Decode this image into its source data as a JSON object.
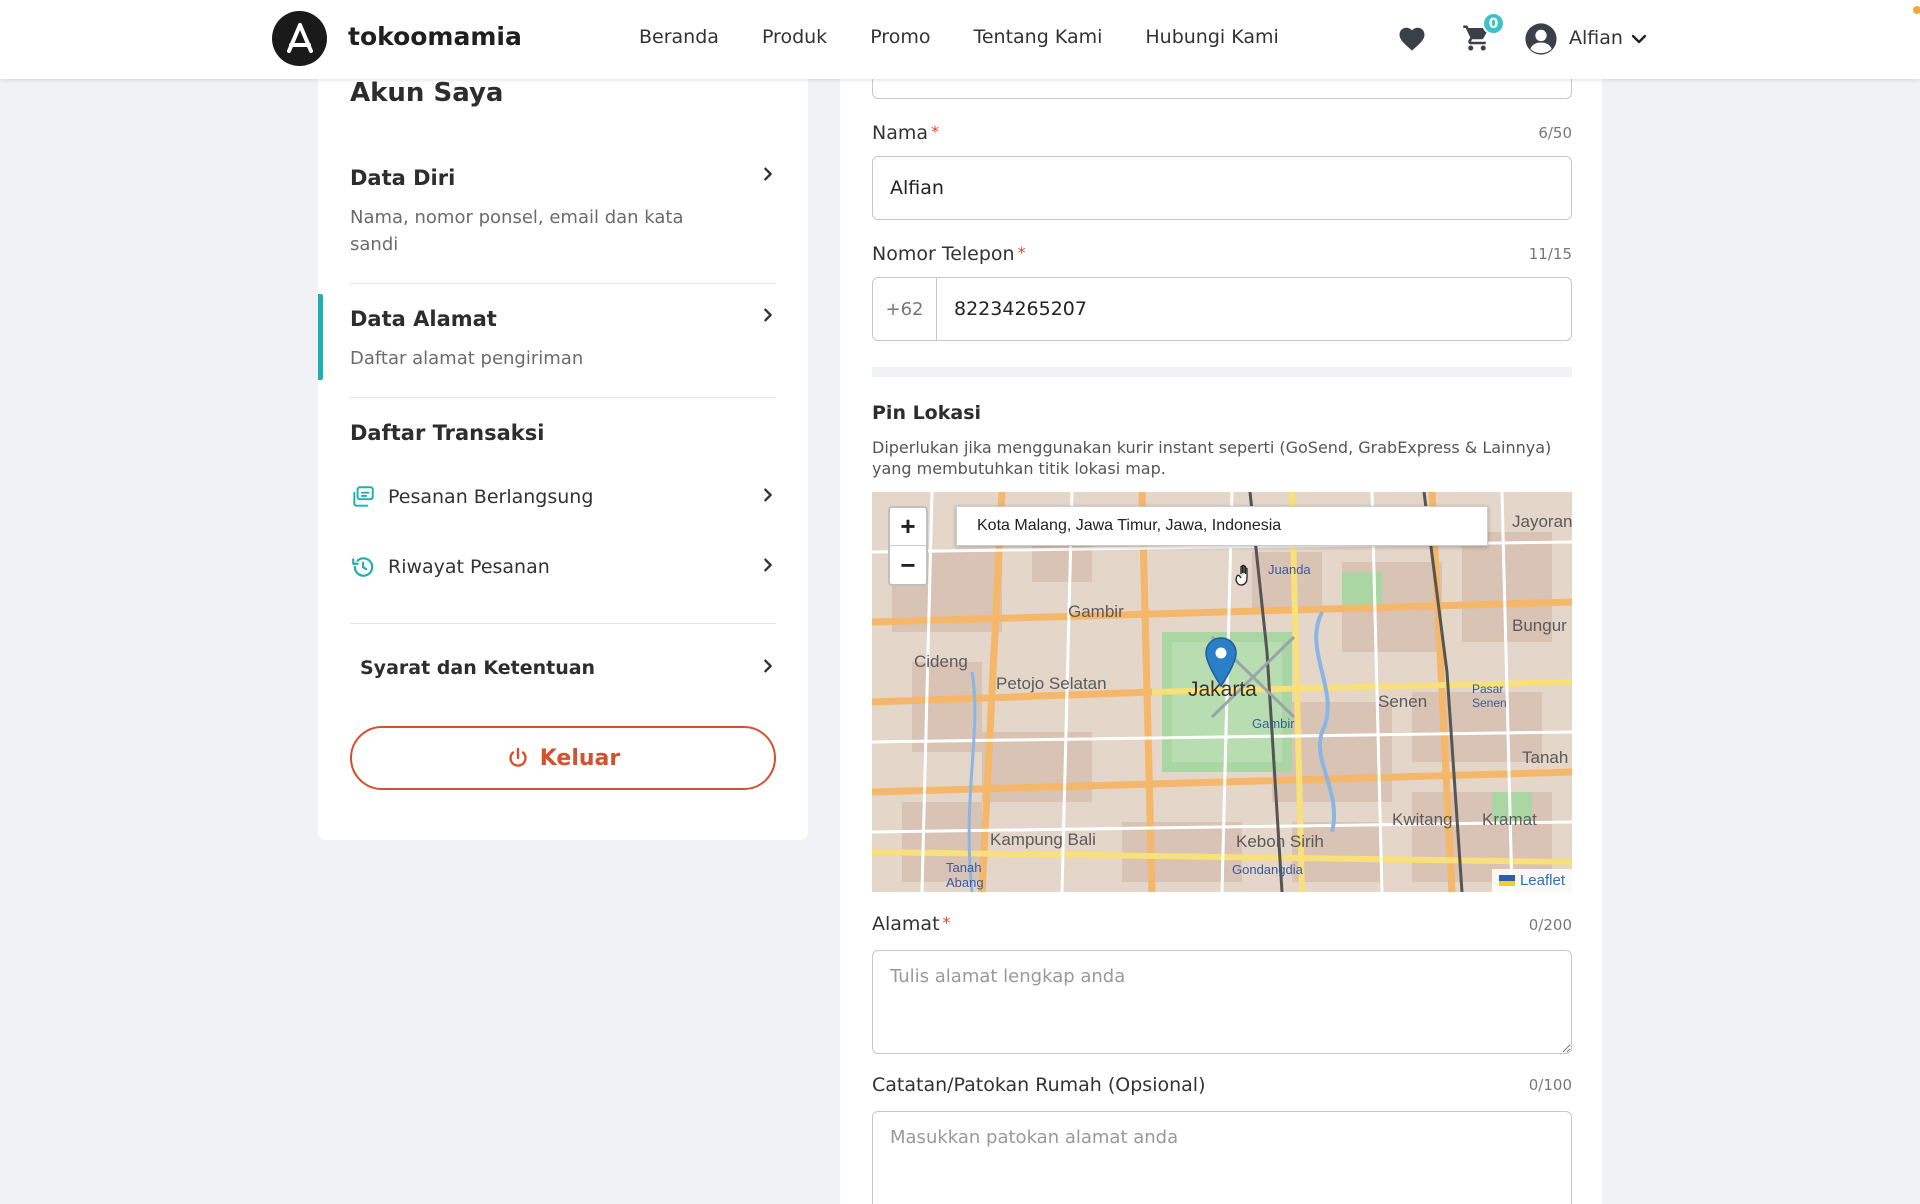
{
  "header": {
    "brand": "tokoomamia",
    "nav": [
      "Beranda",
      "Produk",
      "Promo",
      "Tentang Kami",
      "Hubungi Kami"
    ],
    "cart_count": "0",
    "user_name": "Alfian"
  },
  "sidebar": {
    "title": "Akun Saya",
    "data_diri": {
      "title": "Data Diri",
      "desc": "Nama, nomor ponsel, email dan kata sandi"
    },
    "data_alamat": {
      "title": "Data Alamat",
      "desc": "Daftar alamat pengiriman"
    },
    "transaksi": {
      "title": "Daftar Transaksi",
      "items": [
        "Pesanan Berlangsung",
        "Riwayat Pesanan"
      ]
    },
    "syarat": "Syarat dan Ketentuan",
    "logout": "Keluar"
  },
  "form": {
    "nama": {
      "label": "Nama",
      "counter": "6/50",
      "value": "Alfian"
    },
    "telepon": {
      "label": "Nomor Telepon",
      "counter": "11/15",
      "prefix": "+62",
      "value": "82234265207"
    },
    "pin": {
      "title": "Pin Lokasi",
      "desc": "Diperlukan jika menggunakan kurir instant seperti (GoSend, GrabExpress & Lainnya) yang membutuhkan titik lokasi map."
    },
    "map": {
      "search_value": "Kota Malang, Jawa Timur, Jawa, Indonesia",
      "zoom_in": "+",
      "zoom_out": "−",
      "attribution": "Leaflet",
      "labels": [
        "Gambir",
        "Cideng",
        "Petojo Selatan",
        "Jakarta",
        "Gambir",
        "Senen",
        "Pasar Senen",
        "Kwitang",
        "Kramat",
        "Kampung Bali",
        "Kebon Sirih",
        "Gondangdia",
        "Tanah Abang",
        "Bungur",
        "Tanah",
        "Jayoran",
        "Juanda"
      ]
    },
    "alamat": {
      "label": "Alamat",
      "counter": "0/200",
      "placeholder": "Tulis alamat lengkap anda"
    },
    "catatan": {
      "label": "Catatan/Patokan Rumah (Opsional)",
      "counter": "0/100",
      "placeholder": "Masukkan patokan alamat anda"
    }
  }
}
